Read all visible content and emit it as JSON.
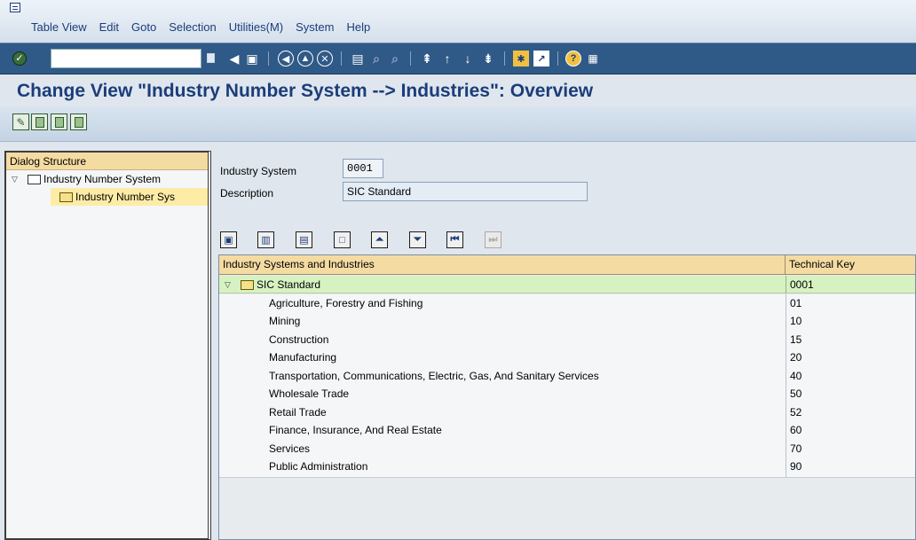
{
  "menu": {
    "items": [
      {
        "label": "Table View",
        "name": "menu-table-view"
      },
      {
        "label": "Edit",
        "name": "menu-edit"
      },
      {
        "label": "Goto",
        "name": "menu-goto"
      },
      {
        "label": "Selection",
        "name": "menu-selection"
      },
      {
        "label": "Utilities(M)",
        "name": "menu-utilities"
      },
      {
        "label": "System",
        "name": "menu-system"
      },
      {
        "label": "Help",
        "name": "menu-help"
      }
    ]
  },
  "toolbar": {
    "command_value": "",
    "icons": [
      "enter-icon",
      "back-icon",
      "save-icon",
      "back-arrow-icon",
      "exit-icon",
      "cancel-icon",
      "print-icon",
      "find-icon",
      "find-next-icon",
      "first-page-icon",
      "previous-page-icon",
      "next-page-icon",
      "last-page-icon",
      "create-session-icon",
      "shortcut-icon",
      "help-icon",
      "layout-icon"
    ]
  },
  "page": {
    "title": "Change View \"Industry Number System --> Industries\": Overview"
  },
  "dialog_structure": {
    "header": "Dialog Structure",
    "items": [
      {
        "label": "Industry Number System",
        "level": 1
      },
      {
        "label": "Industry Number Sys",
        "level": 2
      }
    ]
  },
  "form": {
    "industry_system_label": "Industry System",
    "industry_system_value": "0001",
    "description_label": "Description",
    "description_value": "SIC Standard"
  },
  "table": {
    "headers": {
      "name": "Industry Systems and Industries",
      "key": "Technical Key"
    },
    "root": {
      "name": "SIC Standard",
      "key": "0001"
    },
    "rows": [
      {
        "name": "Agriculture, Forestry and Fishing",
        "key": "01"
      },
      {
        "name": "Mining",
        "key": "10"
      },
      {
        "name": "Construction",
        "key": "15"
      },
      {
        "name": "Manufacturing",
        "key": "20"
      },
      {
        "name": "Transportation, Communications, Electric, Gas, And Sanitary Services",
        "key": "40"
      },
      {
        "name": "Wholesale Trade",
        "key": "50"
      },
      {
        "name": "Retail Trade",
        "key": "52"
      },
      {
        "name": "Finance, Insurance, And Real Estate",
        "key": "60"
      },
      {
        "name": "Services",
        "key": "70"
      },
      {
        "name": "Public Administration",
        "key": "90"
      }
    ]
  },
  "colors": {
    "title": "#1b3d7a",
    "toolbar": "#2f5987",
    "header_bg": "#f4dba2",
    "selected_row": "#d6f2c2"
  }
}
